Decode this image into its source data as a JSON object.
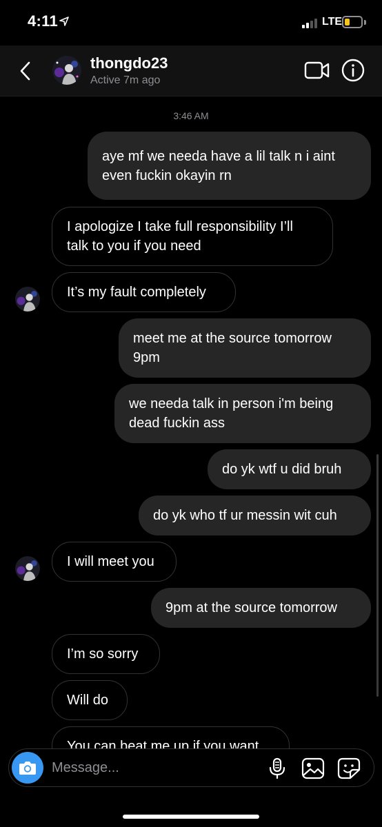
{
  "status_bar": {
    "time": "4:11",
    "network": "LTE",
    "icons": [
      "location-arrow-icon",
      "signal-bars-icon",
      "battery-low-icon"
    ]
  },
  "header": {
    "username": "thongdo23",
    "active_status": "Active 7m ago",
    "icons": [
      "back-chevron-icon",
      "video-call-icon",
      "info-icon"
    ]
  },
  "thread": {
    "timestamp": "3:46 AM",
    "messages": [
      {
        "from": "me",
        "lines": [
          "aye mf we needa have a lil talk n i aint",
          "even fuckin okayin rn"
        ]
      },
      {
        "from": "them",
        "lines": [
          "I apologize I take full responsibility I’ll",
          "talk to you if you need"
        ]
      },
      {
        "from": "them",
        "lines": [
          "It’s my fault completely"
        ]
      },
      {
        "from": "me",
        "lines": [
          "meet me at the source tomorrow",
          "9pm"
        ]
      },
      {
        "from": "me",
        "lines": [
          "we needa talk in person i'm being",
          "dead fuckin ass"
        ]
      },
      {
        "from": "me",
        "lines": [
          "do yk wtf u did bruh"
        ]
      },
      {
        "from": "me",
        "lines": [
          "do yk who tf ur messin wit cuh"
        ]
      },
      {
        "from": "them",
        "lines": [
          "I will meet you"
        ]
      },
      {
        "from": "me",
        "lines": [
          "9pm at the source tomorrow"
        ]
      },
      {
        "from": "them",
        "lines": [
          "I’m so sorry"
        ]
      },
      {
        "from": "them",
        "lines": [
          "Will do"
        ]
      },
      {
        "from": "them",
        "lines": [
          "You can beat me up if you want"
        ]
      }
    ]
  },
  "composer": {
    "placeholder": "Message...",
    "icons": [
      "camera-icon",
      "microphone-icon",
      "gallery-icon",
      "sticker-icon"
    ]
  },
  "colors": {
    "background": "#000000",
    "header_bg": "#121212",
    "sent_bubble": "#262626",
    "received_border": "#333333",
    "camera_button": "#3897f0",
    "secondary_text": "#8e8e93",
    "battery_fill": "#f5c518"
  }
}
